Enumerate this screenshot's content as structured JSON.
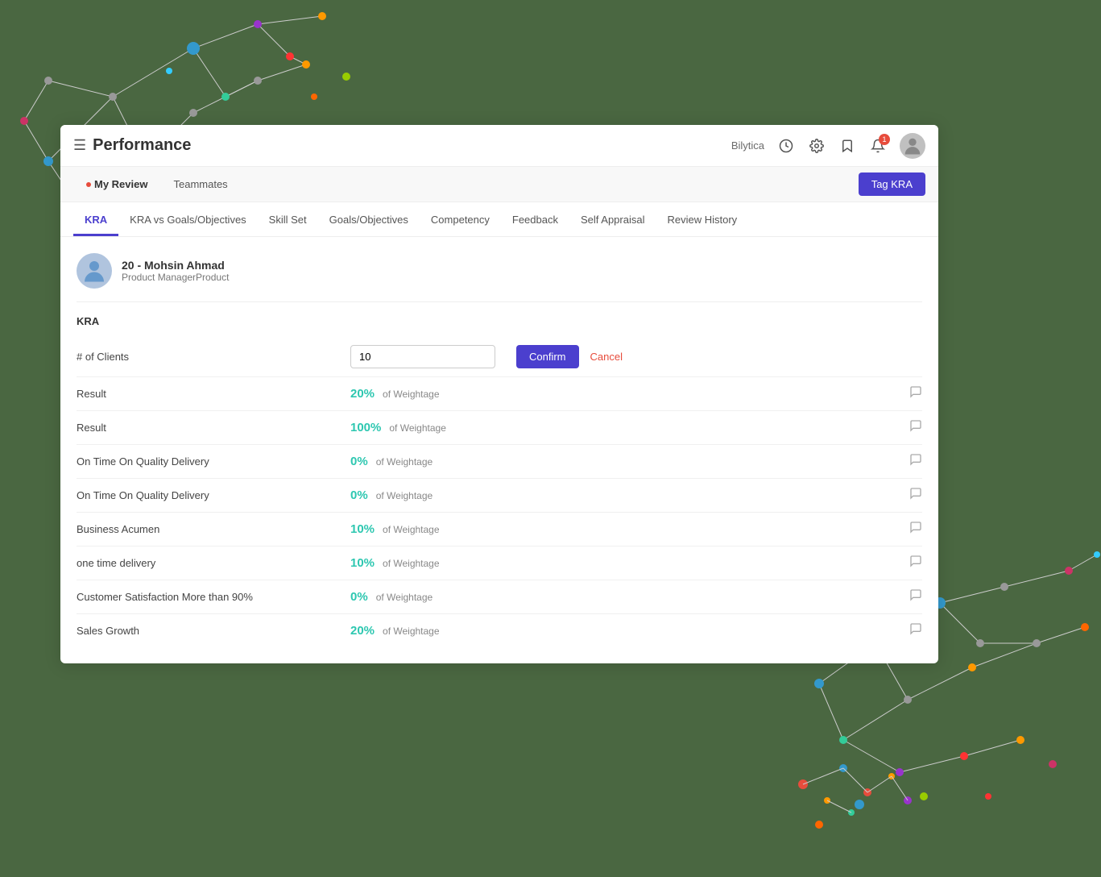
{
  "app": {
    "title": "Performance",
    "bilytica": "Bilytica",
    "tag_kra_label": "Tag KRA",
    "notification_count": "1"
  },
  "sub_nav": {
    "tabs": [
      {
        "label": "My Review",
        "active": true,
        "has_dot": true
      },
      {
        "label": "Teammates",
        "active": false,
        "has_dot": false
      }
    ]
  },
  "main_tabs": [
    {
      "label": "KRA",
      "active": true
    },
    {
      "label": "KRA vs Goals/Objectives",
      "active": false
    },
    {
      "label": "Skill Set",
      "active": false
    },
    {
      "label": "Goals/Objectives",
      "active": false
    },
    {
      "label": "Competency",
      "active": false
    },
    {
      "label": "Feedback",
      "active": false
    },
    {
      "label": "Self Appraisal",
      "active": false
    },
    {
      "label": "Review History",
      "active": false
    }
  ],
  "user": {
    "name": "20 - Mohsin Ahmad",
    "role": "Product ManagerProduct"
  },
  "section_label": "KRA",
  "kra_input_row": {
    "label": "# of Clients",
    "value": "10",
    "confirm_label": "Confirm",
    "cancel_label": "Cancel"
  },
  "kra_rows": [
    {
      "label": "Result",
      "weightage": "20%",
      "suffix": "of Weightage"
    },
    {
      "label": "Result",
      "weightage": "100%",
      "suffix": "of Weightage"
    },
    {
      "label": "On Time On Quality Delivery",
      "weightage": "0%",
      "suffix": "of Weightage"
    },
    {
      "label": "On Time On Quality Delivery",
      "weightage": "0%",
      "suffix": "of Weightage"
    },
    {
      "label": "Business Acumen",
      "weightage": "10%",
      "suffix": "of Weightage"
    },
    {
      "label": "one time delivery",
      "weightage": "10%",
      "suffix": "of Weightage"
    },
    {
      "label": "Customer Satisfaction More than 90%",
      "weightage": "0%",
      "suffix": "of Weightage"
    },
    {
      "label": "Sales Growth",
      "weightage": "20%",
      "suffix": "of Weightage"
    }
  ]
}
